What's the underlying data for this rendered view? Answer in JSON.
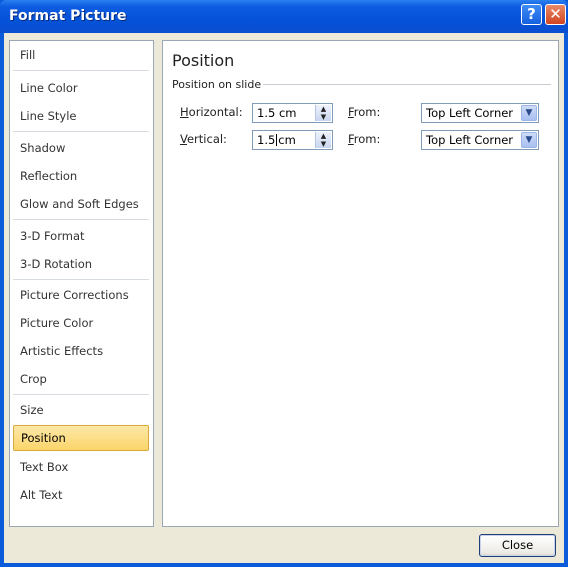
{
  "window": {
    "title": "Format Picture",
    "help_label": "?",
    "close_label": "✕"
  },
  "sidebar": {
    "items": [
      {
        "label": "Fill"
      },
      {
        "label": "Line Color"
      },
      {
        "label": "Line Style"
      },
      {
        "label": "Shadow"
      },
      {
        "label": "Reflection"
      },
      {
        "label": "Glow and Soft Edges"
      },
      {
        "label": "3-D Format"
      },
      {
        "label": "3-D Rotation"
      },
      {
        "label": "Picture Corrections"
      },
      {
        "label": "Picture Color"
      },
      {
        "label": "Artistic Effects"
      },
      {
        "label": "Crop"
      },
      {
        "label": "Size"
      },
      {
        "label": "Position"
      },
      {
        "label": "Text Box"
      },
      {
        "label": "Alt Text"
      }
    ],
    "selected": "Position"
  },
  "panel": {
    "title": "Position",
    "group_label": "Position on slide",
    "horizontal": {
      "label_first": "H",
      "label_rest": "orizontal:",
      "value": "1.5 cm",
      "from_first": "F",
      "from_rest": "rom:",
      "from_value": "Top Left Corner"
    },
    "vertical": {
      "label_first": "V",
      "label_rest": "ertical:",
      "value_before": "1.5",
      "value_after": "cm",
      "from_first": "F",
      "from_rest": "rom:",
      "from_value": "Top Left Corner"
    }
  },
  "footer": {
    "close_label": "Close"
  },
  "icons": {
    "spin_up": "▲",
    "spin_down": "▼",
    "dropdown": "▼"
  }
}
